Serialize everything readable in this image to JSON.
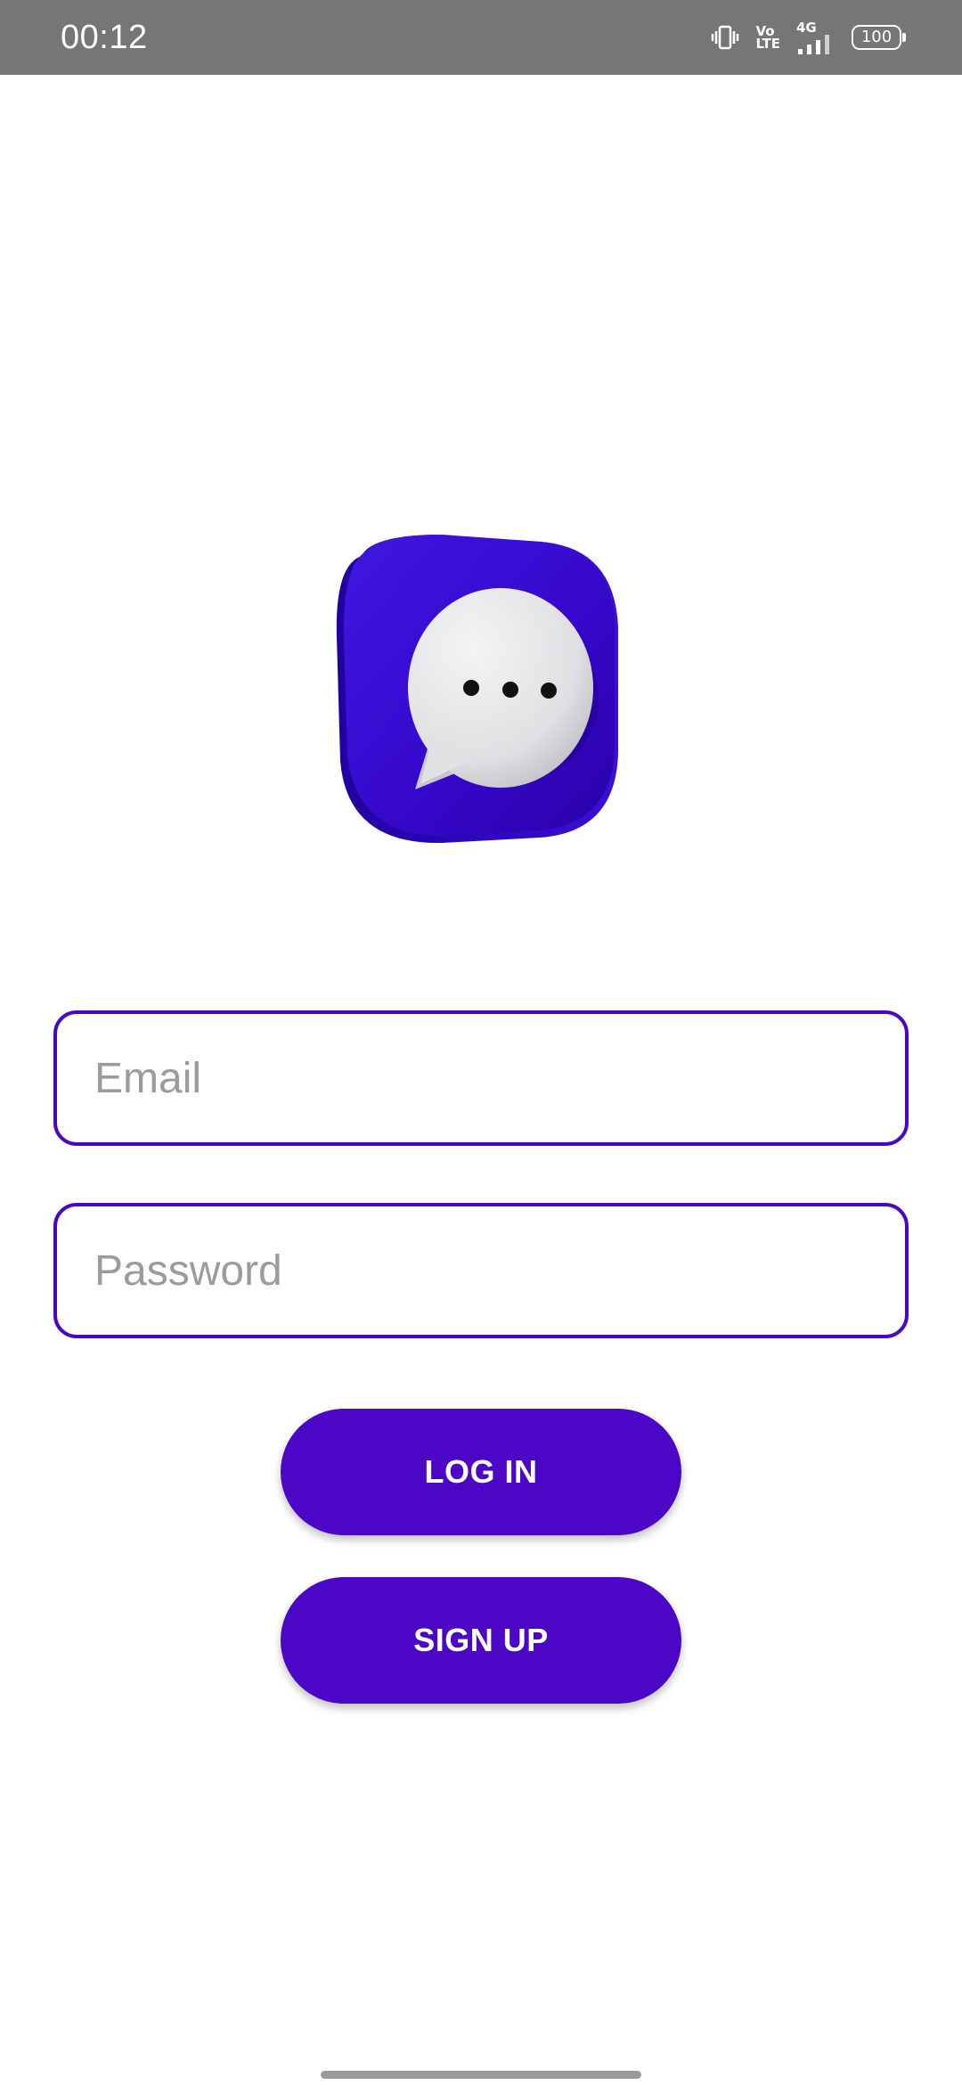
{
  "status_bar": {
    "time": "00:12",
    "network_type": "4G",
    "volte_top": "Vo",
    "volte_bottom": "LTE",
    "battery_level": "100",
    "icons": [
      "vibrate-icon",
      "volte-icon",
      "signal-icon",
      "battery-icon"
    ]
  },
  "logo": {
    "icon": "chat-bubble-icon",
    "tile_color": "#3a0ad0",
    "bubble_color": "#e4e4e6"
  },
  "form": {
    "email_placeholder": "Email",
    "email_value": "",
    "password_placeholder": "Password",
    "password_value": ""
  },
  "buttons": {
    "login_label": "LOG IN",
    "signup_label": "SIGN UP"
  },
  "colors": {
    "accent": "#4b06c6",
    "field_border": "#4707c4",
    "status_bar": "#767676"
  }
}
